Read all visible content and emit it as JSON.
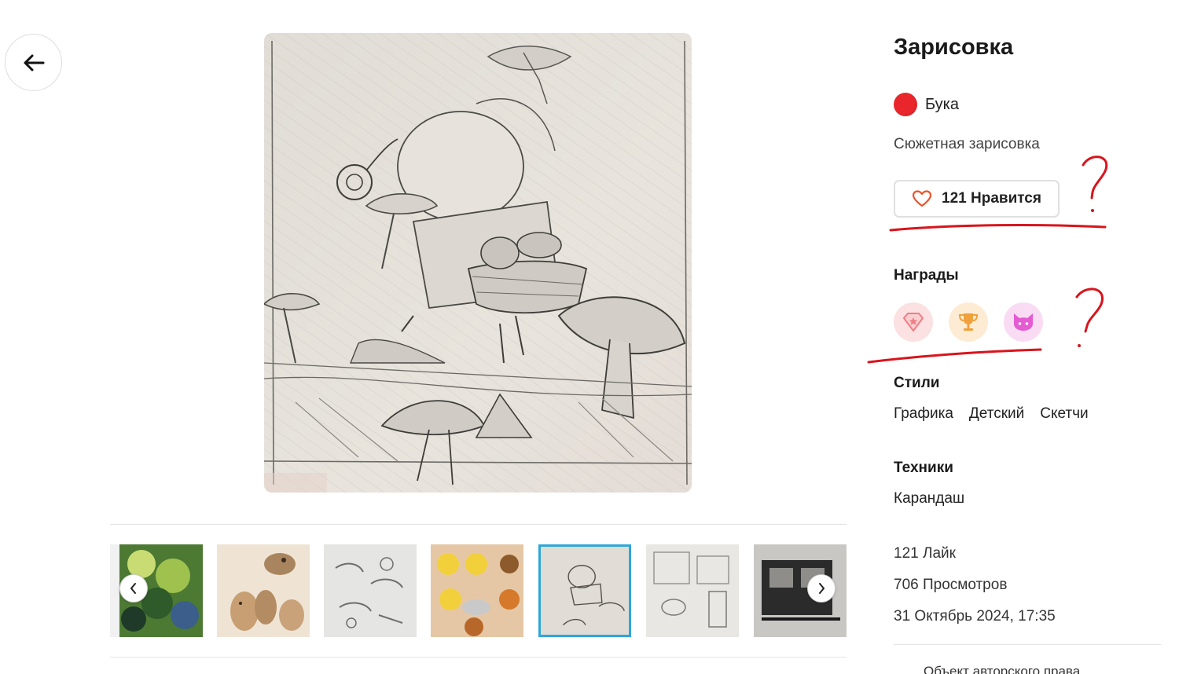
{
  "artwork": {
    "title": "Зарисовка",
    "author": "Бука",
    "description": "Сюжетная зарисовка",
    "like_button_label": "121 Нравится"
  },
  "sections": {
    "awards_heading": "Награды",
    "styles_heading": "Стили",
    "techniques_heading": "Техники"
  },
  "awards": [
    {
      "icon": "diamond-star-icon",
      "bg": "#fbe1e1",
      "color": "#f07d85"
    },
    {
      "icon": "trophy-icon",
      "bg": "#fdebd3",
      "color": "#f0a13a"
    },
    {
      "icon": "cat-icon",
      "bg": "#f9dcf3",
      "color": "#e45bd2"
    }
  ],
  "styles": [
    "Графика",
    "Детский",
    "Скетчи"
  ],
  "techniques": [
    "Карандаш"
  ],
  "stats": {
    "likes": "121 Лайк",
    "views": "706 Просмотров",
    "date": "31 Октябрь 2024, 17:35"
  },
  "copyright": "Объект авторского права",
  "thumbnails": [
    {
      "name": "thumb-green-painting"
    },
    {
      "name": "thumb-pottery-figures"
    },
    {
      "name": "thumb-pencil-sketch-mushrooms"
    },
    {
      "name": "thumb-bee-stickers"
    },
    {
      "name": "thumb-current-sketch",
      "active": true
    },
    {
      "name": "thumb-interior-sketch"
    },
    {
      "name": "thumb-ink-drawing"
    }
  ],
  "colors": {
    "accent": "#2ea7d8",
    "like_heart": "#e8542c",
    "annotation_red": "#d9141c"
  }
}
